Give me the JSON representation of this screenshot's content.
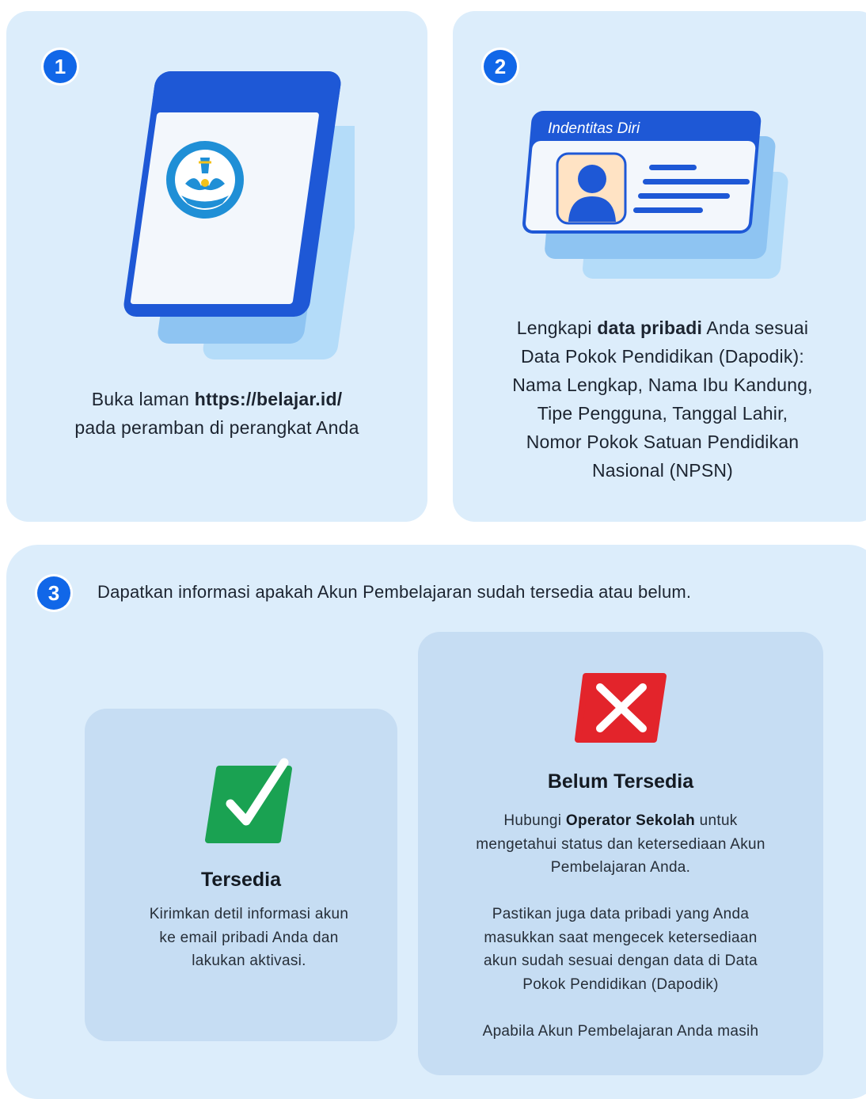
{
  "step1": {
    "number": "1",
    "logo_text": "TUT WURI HANDAYANI",
    "text_prefix": "Buka laman ",
    "url": "https://belajar.id/",
    "text_line2": "pada peramban di perangkat Anda"
  },
  "step2": {
    "number": "2",
    "id_card_title": "Indentitas Diri",
    "text_prefix": "Lengkapi ",
    "bold": "data pribadi",
    "text_rest1": " Anda sesuai",
    "line2": "Data Pokok Pendidikan (Dapodik):",
    "line3": "Nama Lengkap, Nama Ibu Kandung,",
    "line4": "Tipe Pengguna, Tanggal Lahir,",
    "line5": "Nomor Pokok Satuan Pendidikan",
    "line6": "Nasional (NPSN)"
  },
  "step3": {
    "number": "3",
    "heading": "Dapatkan informasi apakah Akun Pembelajaran sudah tersedia atau belum.",
    "available": {
      "title": "Tersedia",
      "line1": "Kirimkan detil informasi akun",
      "line2": "ke email pribadi Anda dan",
      "line3": "lakukan aktivasi."
    },
    "unavailable": {
      "title": "Belum Tersedia",
      "p1_prefix": "Hubungi ",
      "p1_bold": "Operator Sekolah",
      "p1_rest": " untuk",
      "p1_line2": "mengetahui status dan ketersediaan Akun",
      "p1_line3": "Pembelajaran Anda.",
      "p2_line1": "Pastikan juga data pribadi yang Anda",
      "p2_line2": "masukkan saat mengecek ketersediaan",
      "p2_line3": "akun sudah sesuai dengan data di Data",
      "p2_line4": "Pokok Pendidikan (Dapodik)",
      "p3_line1": "Apabila Akun Pembelajaran Anda masih"
    }
  },
  "colors": {
    "card_bg": "#dcedfb",
    "badge_blue": "#1167e8",
    "check_green": "#1aa252",
    "cross_red": "#e3242b"
  },
  "icons": [
    "phone-illustration",
    "id-card-illustration",
    "check-icon",
    "cross-icon"
  ]
}
